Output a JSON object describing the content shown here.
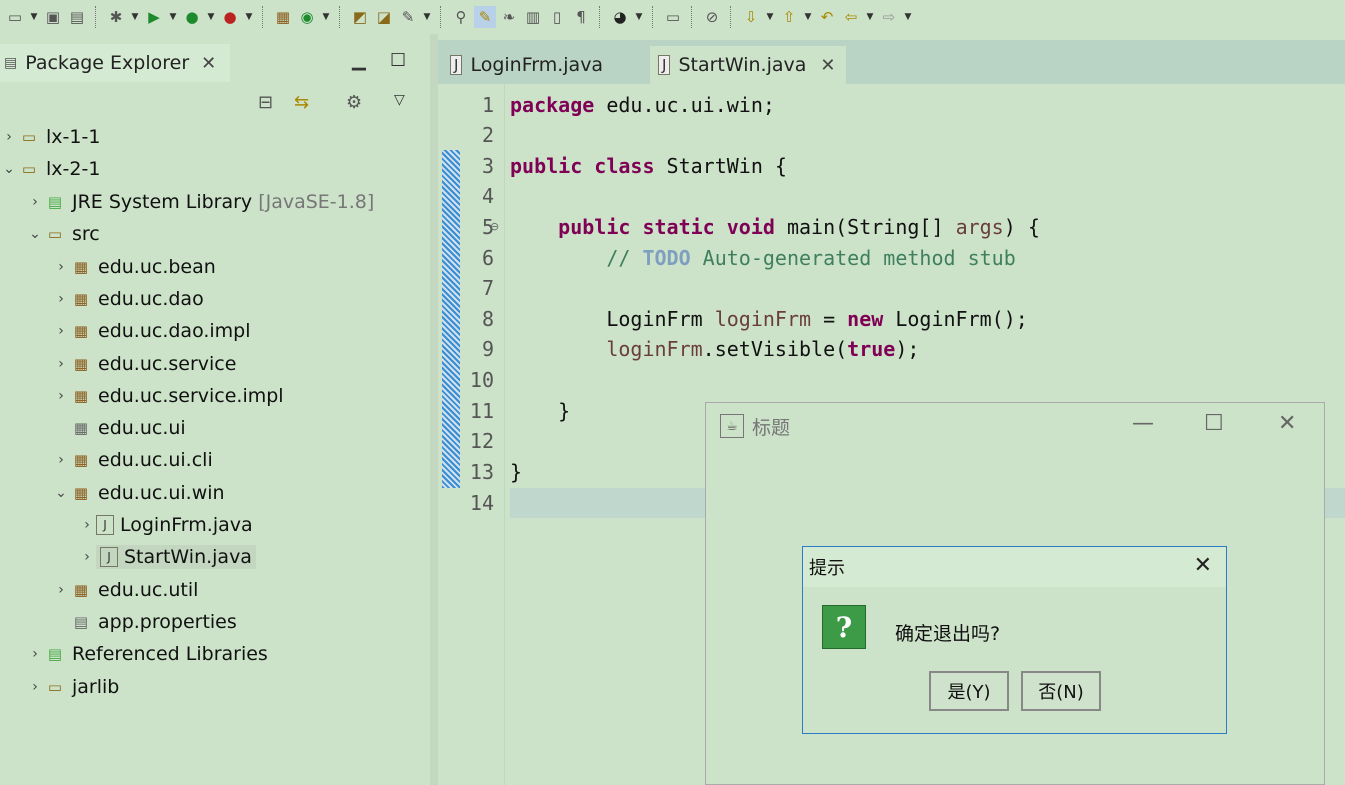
{
  "toolbar": {
    "icons": [
      "new-icon",
      "save-icon",
      "save-all-icon",
      "debug-icon",
      "run-icon",
      "run-server-icon",
      "run-external-icon",
      "new-java-package-icon",
      "new-class-icon",
      "open-type-icon",
      "open-folder-icon",
      "search-icon",
      "pin-icon",
      "toggle-mark-occurrences-icon",
      "toggle-breadcrumb-icon",
      "next-annotation-icon",
      "show-whitespace-icon",
      "pilcrow-icon",
      "user-icon",
      "console-icon",
      "skip-breakpoints-icon",
      "next-annotation-down-icon",
      "prev-annotation-up-icon",
      "last-edit-icon",
      "back-icon",
      "forward-icon"
    ]
  },
  "package_explorer": {
    "title": "Package Explorer",
    "tree": [
      {
        "label": "lx-1-1",
        "type": "project",
        "expanded": false
      },
      {
        "label": "lx-2-1",
        "type": "project",
        "expanded": true
      },
      {
        "label": "JRE System Library",
        "decoration": "[JavaSE-1.8]",
        "type": "library",
        "expanded": false
      },
      {
        "label": "src",
        "type": "source-folder",
        "expanded": true
      },
      {
        "label": "edu.uc.bean",
        "type": "package",
        "expanded": false
      },
      {
        "label": "edu.uc.dao",
        "type": "package",
        "expanded": false
      },
      {
        "label": "edu.uc.dao.impl",
        "type": "package",
        "expanded": false
      },
      {
        "label": "edu.uc.service",
        "type": "package",
        "expanded": false
      },
      {
        "label": "edu.uc.service.impl",
        "type": "package",
        "expanded": false
      },
      {
        "label": "edu.uc.ui",
        "type": "empty-package",
        "expanded": null
      },
      {
        "label": "edu.uc.ui.cli",
        "type": "package",
        "expanded": false
      },
      {
        "label": "edu.uc.ui.win",
        "type": "package",
        "expanded": true
      },
      {
        "label": "LoginFrm.java",
        "type": "java-file",
        "expanded": false
      },
      {
        "label": "StartWin.java",
        "type": "java-file",
        "expanded": false,
        "selected": true
      },
      {
        "label": "edu.uc.util",
        "type": "package",
        "expanded": false
      },
      {
        "label": "app.properties",
        "type": "file",
        "expanded": null
      },
      {
        "label": "Referenced Libraries",
        "type": "library",
        "expanded": false
      },
      {
        "label": "jarlib",
        "type": "folder",
        "expanded": false
      }
    ]
  },
  "editor": {
    "tabs": [
      {
        "label": "LoginFrm.java",
        "active": false
      },
      {
        "label": "StartWin.java",
        "active": true
      }
    ],
    "line_numbers": [
      "1",
      "2",
      "3",
      "4",
      "5",
      "6",
      "7",
      "8",
      "9",
      "10",
      "11",
      "12",
      "13",
      "14"
    ],
    "lines": {
      "l1_kw": "package",
      "l1_rest": " edu.uc.ui.win;",
      "l3_kw1": "public",
      "l3_kw2": "class",
      "l3_rest": " StartWin {",
      "l5_kw1": "public",
      "l5_kw2": "static",
      "l5_kw3": "void",
      "l5_a": " main(String[] ",
      "l5_param": "args",
      "l5_b": ") {",
      "l6_a": "// ",
      "l6_todo": "TODO",
      "l6_b": " Auto-generated method stub",
      "l8_a": "LoginFrm ",
      "l8_var": "loginFrm",
      "l8_b": " = ",
      "l8_kw": "new",
      "l8_c": " LoginFrm();",
      "l9_var": "loginFrm",
      "l9_a": ".setVisible(",
      "l9_kw": "true",
      "l9_b": ");",
      "l11": "}",
      "l13": "}"
    }
  },
  "frame_window": {
    "title": "标题",
    "controls": [
      "minimize-icon",
      "maximize-icon",
      "close-icon"
    ]
  },
  "dialog": {
    "title": "提示",
    "message": "确定退出吗?",
    "yes_label": "是(Y)",
    "no_label": "否(N)"
  },
  "colors": {
    "background": "#cce3c9",
    "keyword": "#7f0055",
    "comment": "#3f7f5f",
    "dialog_border": "#2a7bc8"
  }
}
